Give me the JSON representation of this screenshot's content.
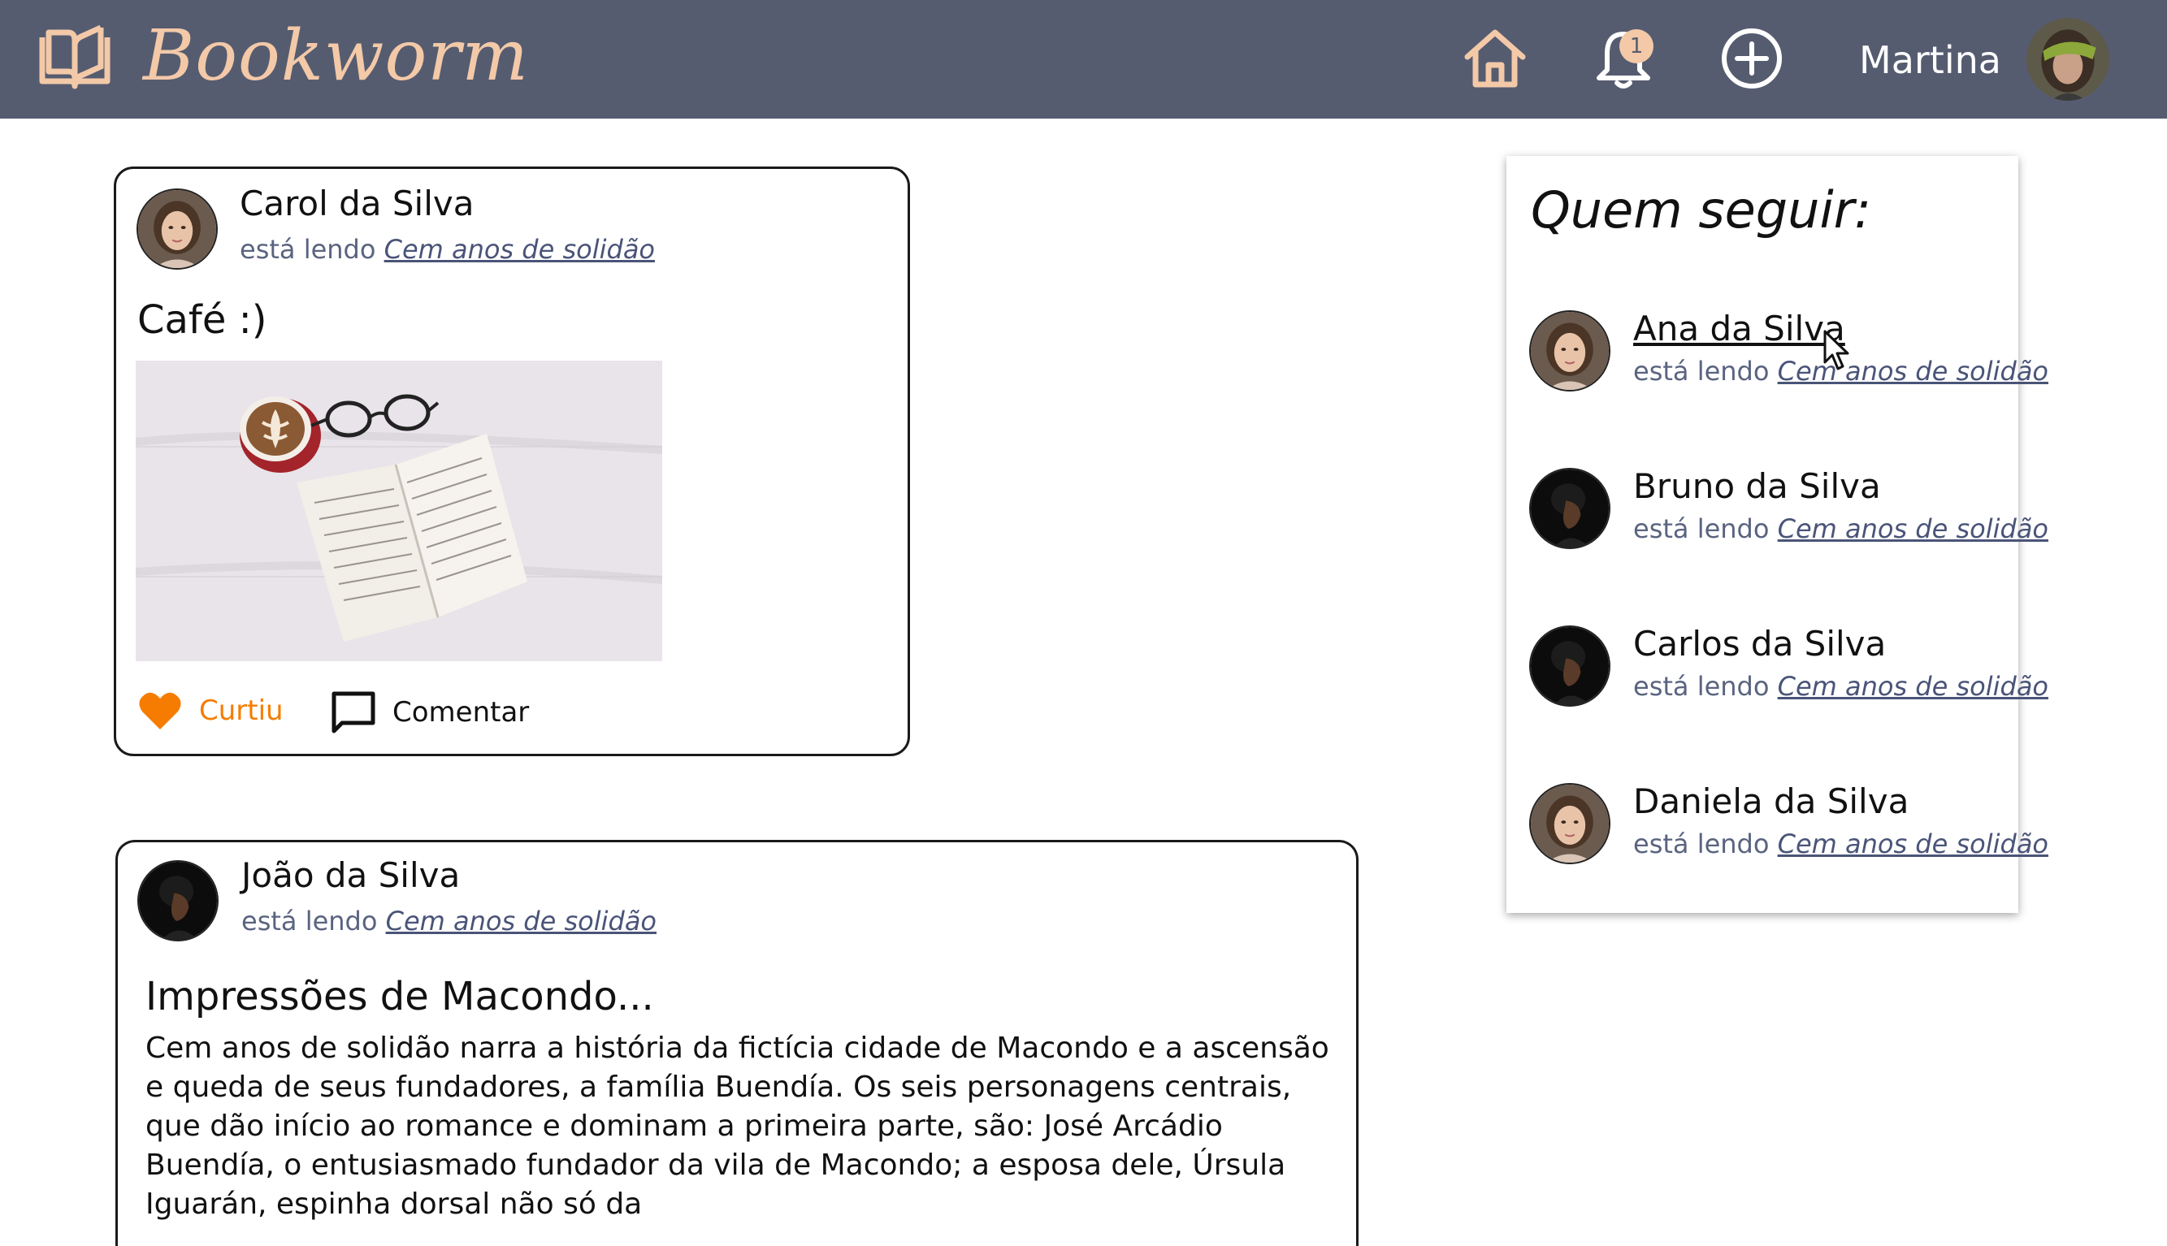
{
  "header": {
    "logo_icon": "open-book-icon",
    "app_name": "Bookworm",
    "nav": [
      {
        "icon": "home-icon"
      },
      {
        "icon": "bell-icon",
        "badge": "1"
      },
      {
        "icon": "plus-circle-icon"
      }
    ],
    "user_name": "Martina",
    "colors": {
      "bar": "#565c70",
      "accent": "#f3c9a8"
    }
  },
  "posts": [
    {
      "author": "Carol da Silva",
      "reading_prefix": "está lendo",
      "book": "Cem anos de solidão",
      "title": "Café :)",
      "image": "coffee-glasses-book-photo",
      "like_label": "Curtiu",
      "like_color": "#f57c00",
      "comment_label": "Comentar"
    },
    {
      "author": "João da Silva",
      "reading_prefix": "está lendo",
      "book": "Cem anos de solidão",
      "title": "Impressões de Macondo...",
      "body": "Cem anos de solidão narra a história da fictícia cidade de Macondo e a ascensão e queda de seus fundadores, a família Buendía. Os seis personagens centrais, que dão início ao romance e dominam a primeira parte, são: José Arcádio Buendía, o entusiasmado fundador da vila de Macondo; a esposa dele, Úrsula Iguarán, espinha dorsal não só da"
    }
  ],
  "sidebar": {
    "title": "Quem seguir:",
    "users": [
      {
        "name": "Ana da Silva",
        "reading_prefix": "está lendo",
        "book": "Cem anos de solidão"
      },
      {
        "name": "Bruno da Silva",
        "reading_prefix": "está lendo",
        "book": "Cem anos de solidão"
      },
      {
        "name": "Carlos da Silva",
        "reading_prefix": "está lendo",
        "book": "Cem anos de solidão"
      },
      {
        "name": "Daniela da Silva",
        "reading_prefix": "está lendo",
        "book": "Cem anos de solidão"
      }
    ]
  }
}
